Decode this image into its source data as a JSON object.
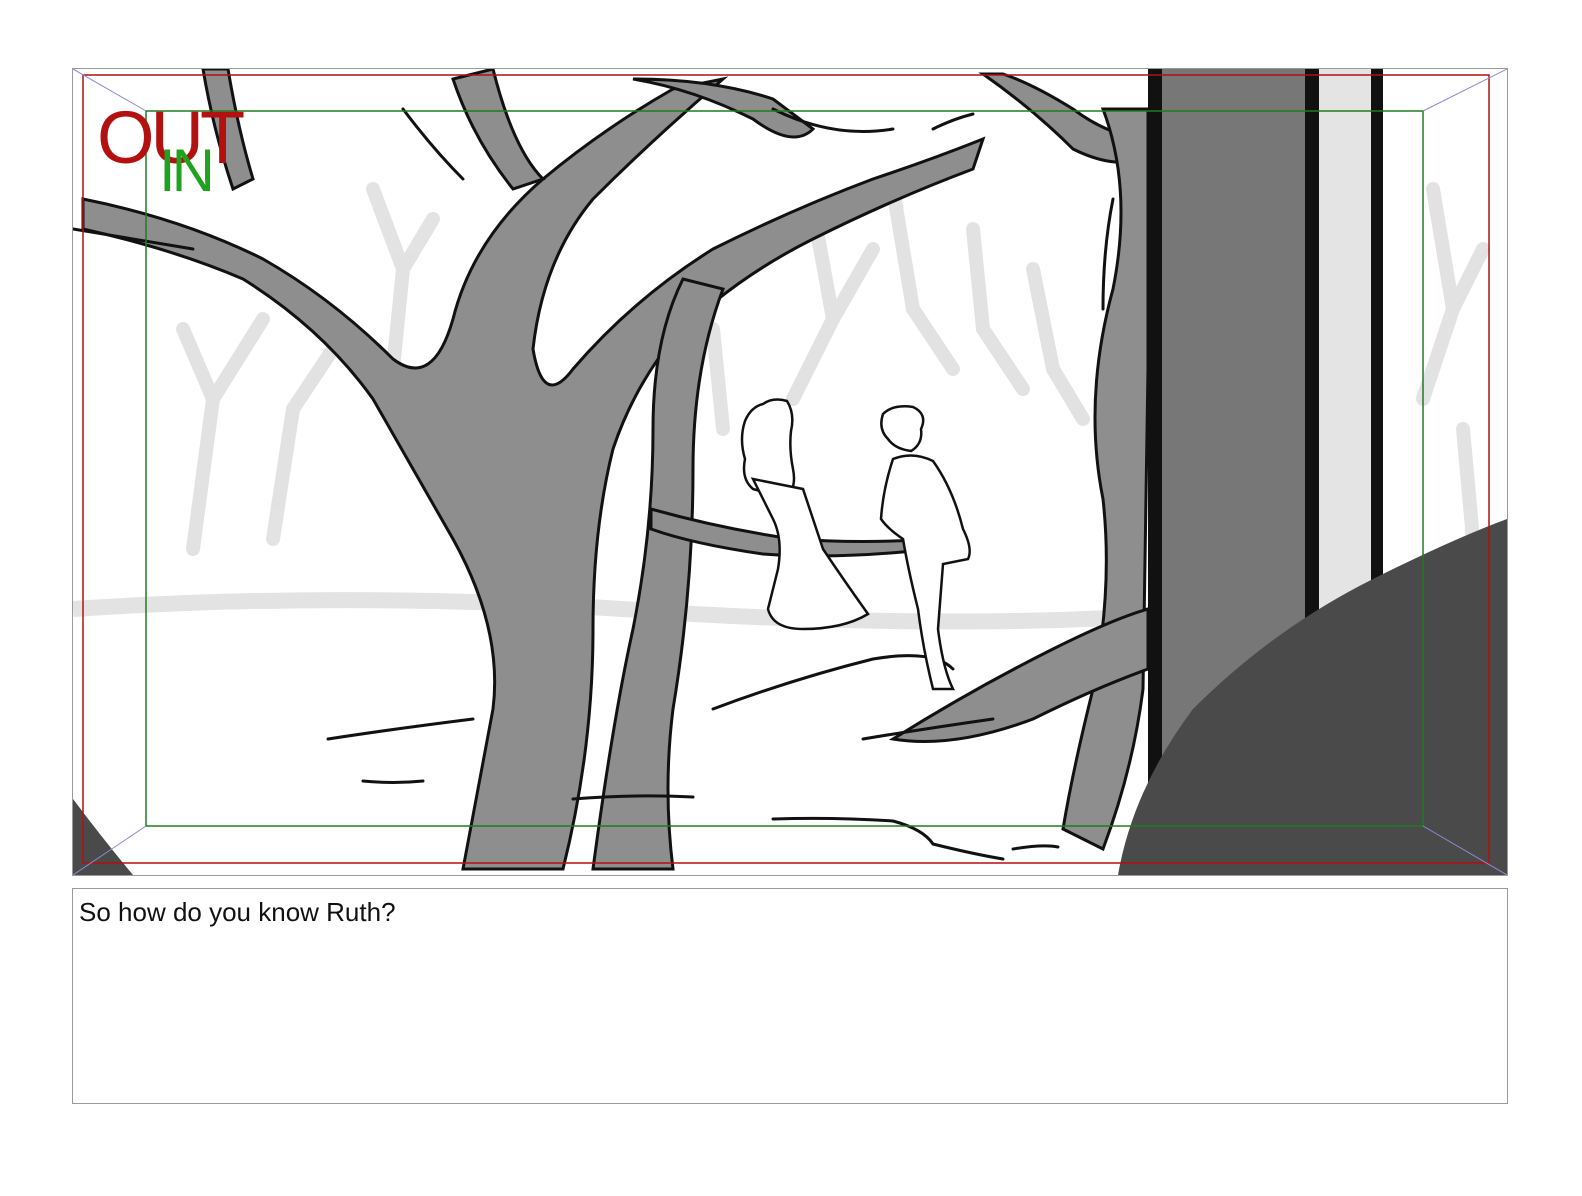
{
  "storyboard": {
    "frame": {
      "overlays": {
        "out_label": "OUT",
        "in_label": "IN",
        "out_color": "#b31010",
        "in_color": "#1fa31f",
        "title_safe_color": "#1f7a1f",
        "action_safe_color": "#b31010",
        "corner_guide_color": "#8a8ad8"
      },
      "art": {
        "style": "grayscale pencil sketch",
        "trunk_fill": "#8e8e8e",
        "shadow_fill": "#4a4a4a",
        "line_color": "#111111",
        "background_tree_color": "#dcdcdc"
      }
    },
    "dialogue": {
      "text": "So how do you know Ruth?"
    }
  }
}
